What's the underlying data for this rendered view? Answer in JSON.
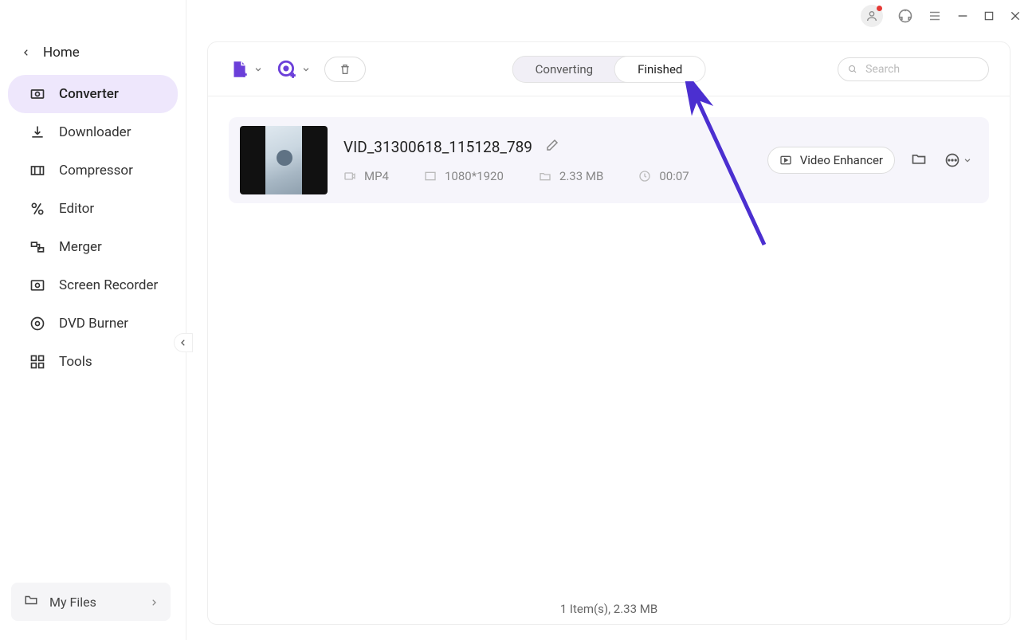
{
  "sidebar": {
    "home": "Home",
    "items": [
      {
        "label": "Converter"
      },
      {
        "label": "Downloader"
      },
      {
        "label": "Compressor"
      },
      {
        "label": "Editor"
      },
      {
        "label": "Merger"
      },
      {
        "label": "Screen Recorder"
      },
      {
        "label": "DVD Burner"
      },
      {
        "label": "Tools"
      }
    ],
    "my_files": "My Files"
  },
  "toolbar": {
    "tabs": {
      "converting": "Converting",
      "finished": "Finished"
    },
    "search_placeholder": "Search"
  },
  "file": {
    "name": "VID_31300618_115128_789",
    "format": "MP4",
    "resolution": "1080*1920",
    "size": "2.33 MB",
    "duration": "00:07",
    "enhancer": "Video Enhancer"
  },
  "status": "1 Item(s), 2.33 MB"
}
